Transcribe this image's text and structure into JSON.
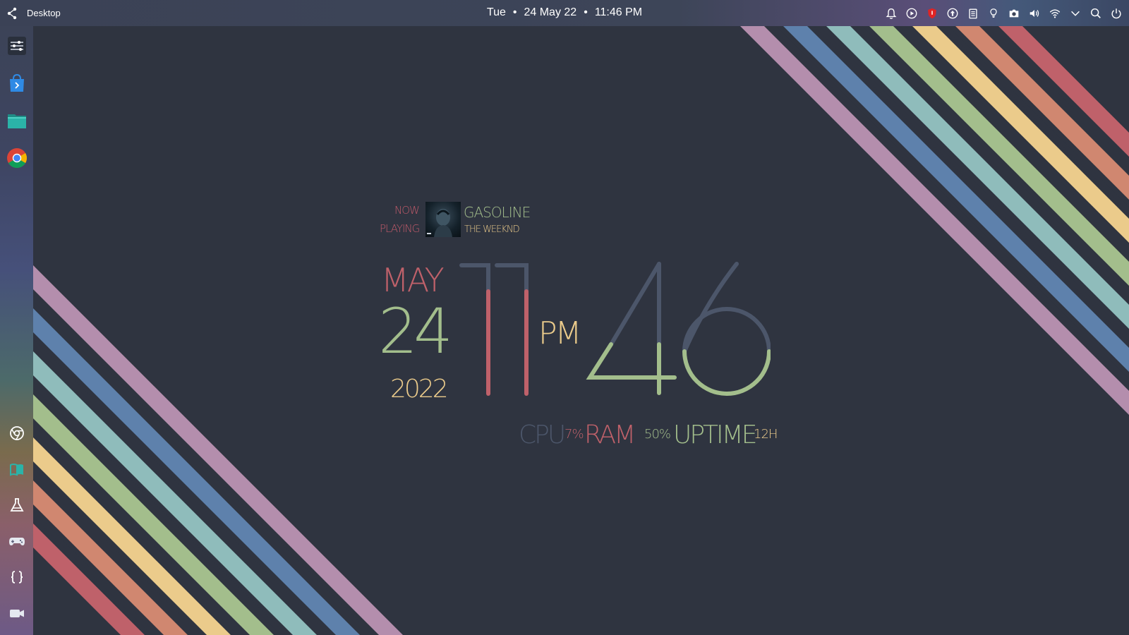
{
  "topbar": {
    "title": "Desktop",
    "clock": {
      "day": "Tue",
      "date": "24 May 22",
      "time": "11:46 PM"
    },
    "tray_icons": [
      "notifications-icon",
      "media-play-icon",
      "shield-icon",
      "upload-icon",
      "clipboard-icon",
      "lightbulb-icon",
      "camera-icon",
      "volume-icon",
      "wifi-icon",
      "chevron-down-icon",
      "search-icon",
      "power-icon"
    ]
  },
  "dock": {
    "items": [
      "settings-sliders-icon",
      "software-store-icon",
      "files-folder-icon",
      "chrome-icon",
      "chrome-outline-icon",
      "book-icon",
      "flask-icon",
      "gamepad-icon",
      "code-braces-icon",
      "video-camera-icon"
    ]
  },
  "widget": {
    "now_playing": {
      "label_now": "NOW",
      "label_playing": "PLAYING",
      "song": "GASOLINE",
      "artist": "THE WEEKND"
    },
    "date": {
      "month": "MAY",
      "day": "24",
      "year": "2022"
    },
    "time": {
      "hour": "11",
      "minute": "46",
      "ampm": "PM"
    },
    "stats": {
      "cpu_label": "CPU",
      "cpu_value": "7%",
      "ram_label": "RAM",
      "ram_value": "50%",
      "uptime_label": "UPTIME",
      "uptime_value": "12H"
    }
  },
  "colors": {
    "background": "#2f3440",
    "red": "#bf616a",
    "orange": "#d08770",
    "yellow": "#ebcb8b",
    "green": "#a3be8c",
    "cyan": "#8fbcbb",
    "blue": "#5e81ac",
    "purple": "#b48ead",
    "slate": "#4c566a"
  }
}
